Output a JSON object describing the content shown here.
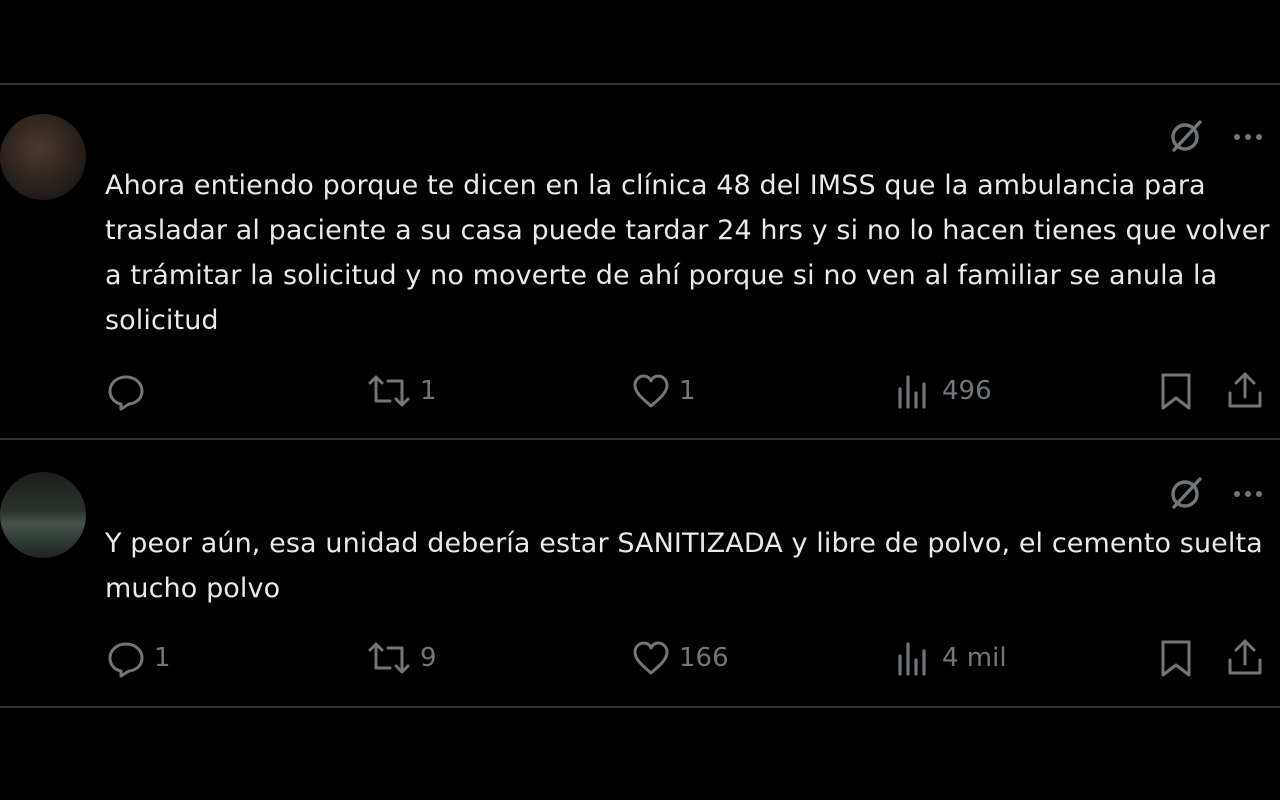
{
  "posts": [
    {
      "text": "Ahora entiendo porque te dicen en la clínica 48 del IMSS que la ambulancia para trasladar al paciente a su casa puede tardar 24 hrs y si no lo hacen tienes que volver a trámitar la solicitud y no moverte de ahí porque si no ven al familiar se anula la solicitud",
      "replies": "",
      "reposts": "1",
      "likes": "1",
      "views": "496"
    },
    {
      "text": "Y peor aún, esa unidad debería estar SANITIZADA y libre de polvo, el cemento suelta mucho polvo",
      "replies": "1",
      "reposts": "9",
      "likes": "166",
      "views": "4 mil"
    }
  ],
  "icons": {
    "grok": "grok-slash-icon",
    "more": "more-dots-icon",
    "reply": "reply-bubble-icon",
    "repost": "repost-icon",
    "like": "heart-icon",
    "views": "views-bars-icon",
    "bookmark": "bookmark-icon",
    "share": "share-icon"
  },
  "colors": {
    "background": "#000000",
    "text": "#e7e9ea",
    "muted": "#71767b",
    "divider": "#2f3336"
  }
}
